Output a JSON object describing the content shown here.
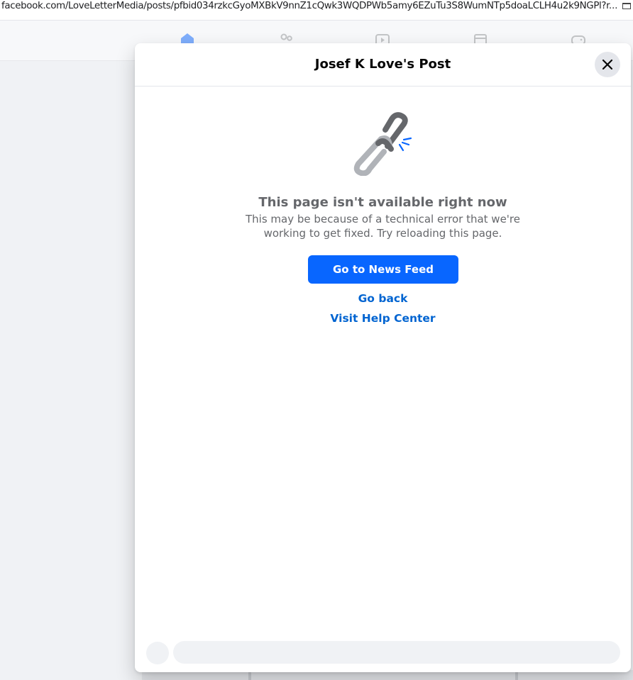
{
  "browser": {
    "url": "facebook.com/LoveLetterMedia/posts/pfbid034rzkcGyoMXBkV9nnZ1cQwk3WQDPWb5amy6EZuTu3S8WumNTp5doaLCLH4u2k9NGPl?rdi",
    "url_overflow": "..."
  },
  "nav": {
    "icons": [
      "home-icon",
      "friends-icon",
      "watch-icon",
      "marketplace-icon",
      "gaming-icon"
    ]
  },
  "dialog": {
    "title": "Josef K Love's Post",
    "error": {
      "icon": "broken-link-icon",
      "title": "This page isn't available right now",
      "description": "This may be because of a technical error that we're working to get fixed. Try reloading this page.",
      "primary_button": "Go to News Feed",
      "go_back": "Go back",
      "help_center": "Visit Help Center"
    }
  },
  "colors": {
    "primary": "#0866ff",
    "link": "#0064d1",
    "secondary_text": "#65676b"
  }
}
